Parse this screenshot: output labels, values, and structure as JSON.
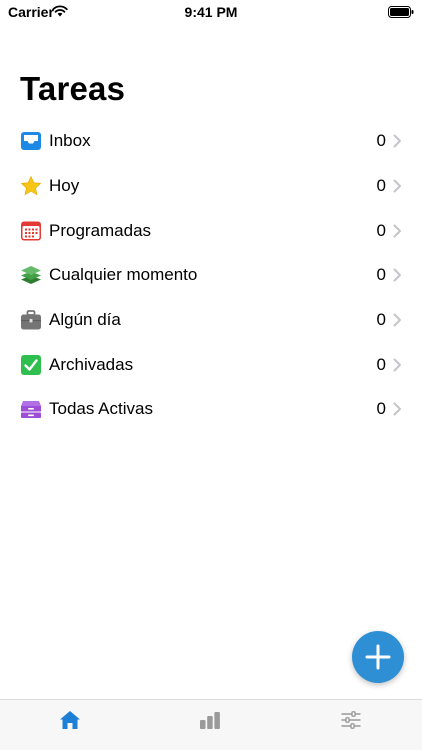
{
  "status_bar": {
    "carrier": "Carrier",
    "time": "9:41 PM"
  },
  "page": {
    "title": "Tareas"
  },
  "lists": [
    {
      "label": "Inbox",
      "count": "0",
      "icon": "inbox-tray-icon",
      "color": "#1e88e5"
    },
    {
      "label": "Hoy",
      "count": "0",
      "icon": "star-icon",
      "color": "#f5c518"
    },
    {
      "label": "Programadas",
      "count": "0",
      "icon": "calendar-icon",
      "color": "#e53935"
    },
    {
      "label": "Cualquier momento",
      "count": "0",
      "icon": "layers-icon",
      "color": "#43a047"
    },
    {
      "label": "Algún día",
      "count": "0",
      "icon": "briefcase-icon",
      "color": "#757575"
    },
    {
      "label": "Archivadas",
      "count": "0",
      "icon": "checkbox-icon",
      "color": "#2fbf4f"
    },
    {
      "label": "Todas Activas",
      "count": "0",
      "icon": "archive-box-icon",
      "color": "#9c4fd6"
    }
  ],
  "tab_bar": {
    "tabs": [
      {
        "icon": "home-icon",
        "active": true,
        "color": "#1e7fd6"
      },
      {
        "icon": "bar-chart-icon",
        "active": false,
        "color": "#9a9a9a"
      },
      {
        "icon": "sliders-icon",
        "active": false,
        "color": "#9a9a9a"
      }
    ]
  },
  "fab": {
    "icon": "plus-icon",
    "color": "#2e8fd5"
  }
}
